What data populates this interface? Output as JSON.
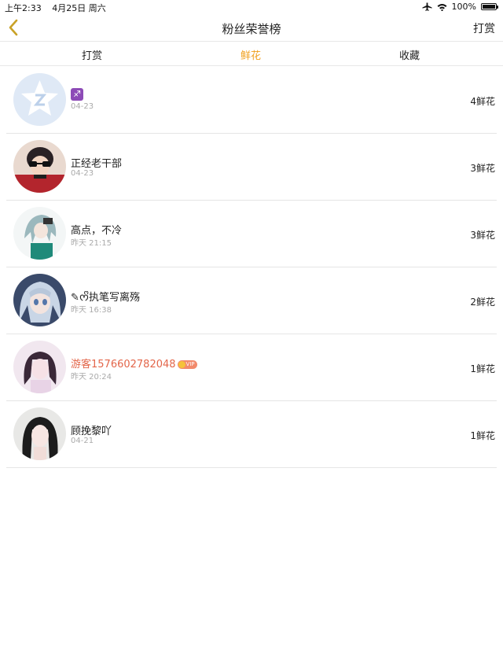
{
  "status_bar": {
    "time": "上午2:33",
    "date": "4月25日 周六",
    "battery": "100%",
    "battery_level": 1.0,
    "icons": [
      "airplane-icon",
      "wifi-icon",
      "battery-icon"
    ]
  },
  "nav": {
    "back_icon": "chevron-left-icon",
    "title": "粉丝荣誉榜",
    "action": "打赏"
  },
  "tabs": [
    {
      "label": "打赏",
      "active": false
    },
    {
      "label": "鲜花",
      "active": true
    },
    {
      "label": "收藏",
      "active": false
    }
  ],
  "colors": {
    "accent": "#f0a01e",
    "vip_name": "#e3664a",
    "divider": "#e5e5e5",
    "timestamp": "#aaaaaa"
  },
  "fans": [
    {
      "name": "",
      "name_icon": "sagittarius-icon",
      "name_icon_glyph": "♐",
      "time": "04-23",
      "count": "4鲜花",
      "vip": false
    },
    {
      "name": "正经老干部",
      "time": "04-23",
      "count": "3鲜花",
      "vip": false
    },
    {
      "name": "高点，不冷",
      "time": "昨天 21:15",
      "count": "3鲜花",
      "vip": false
    },
    {
      "name": "✎ᰔᩚ执笔写离殇",
      "time": "昨天 16:38",
      "count": "2鲜花",
      "vip": false
    },
    {
      "name": "游客1576602782048",
      "time": "昨天 20:24",
      "count": "1鲜花",
      "vip": true,
      "badge": "VIP"
    },
    {
      "name": "顾挽黎吖",
      "time": "04-21",
      "count": "1鲜花",
      "vip": false
    }
  ]
}
